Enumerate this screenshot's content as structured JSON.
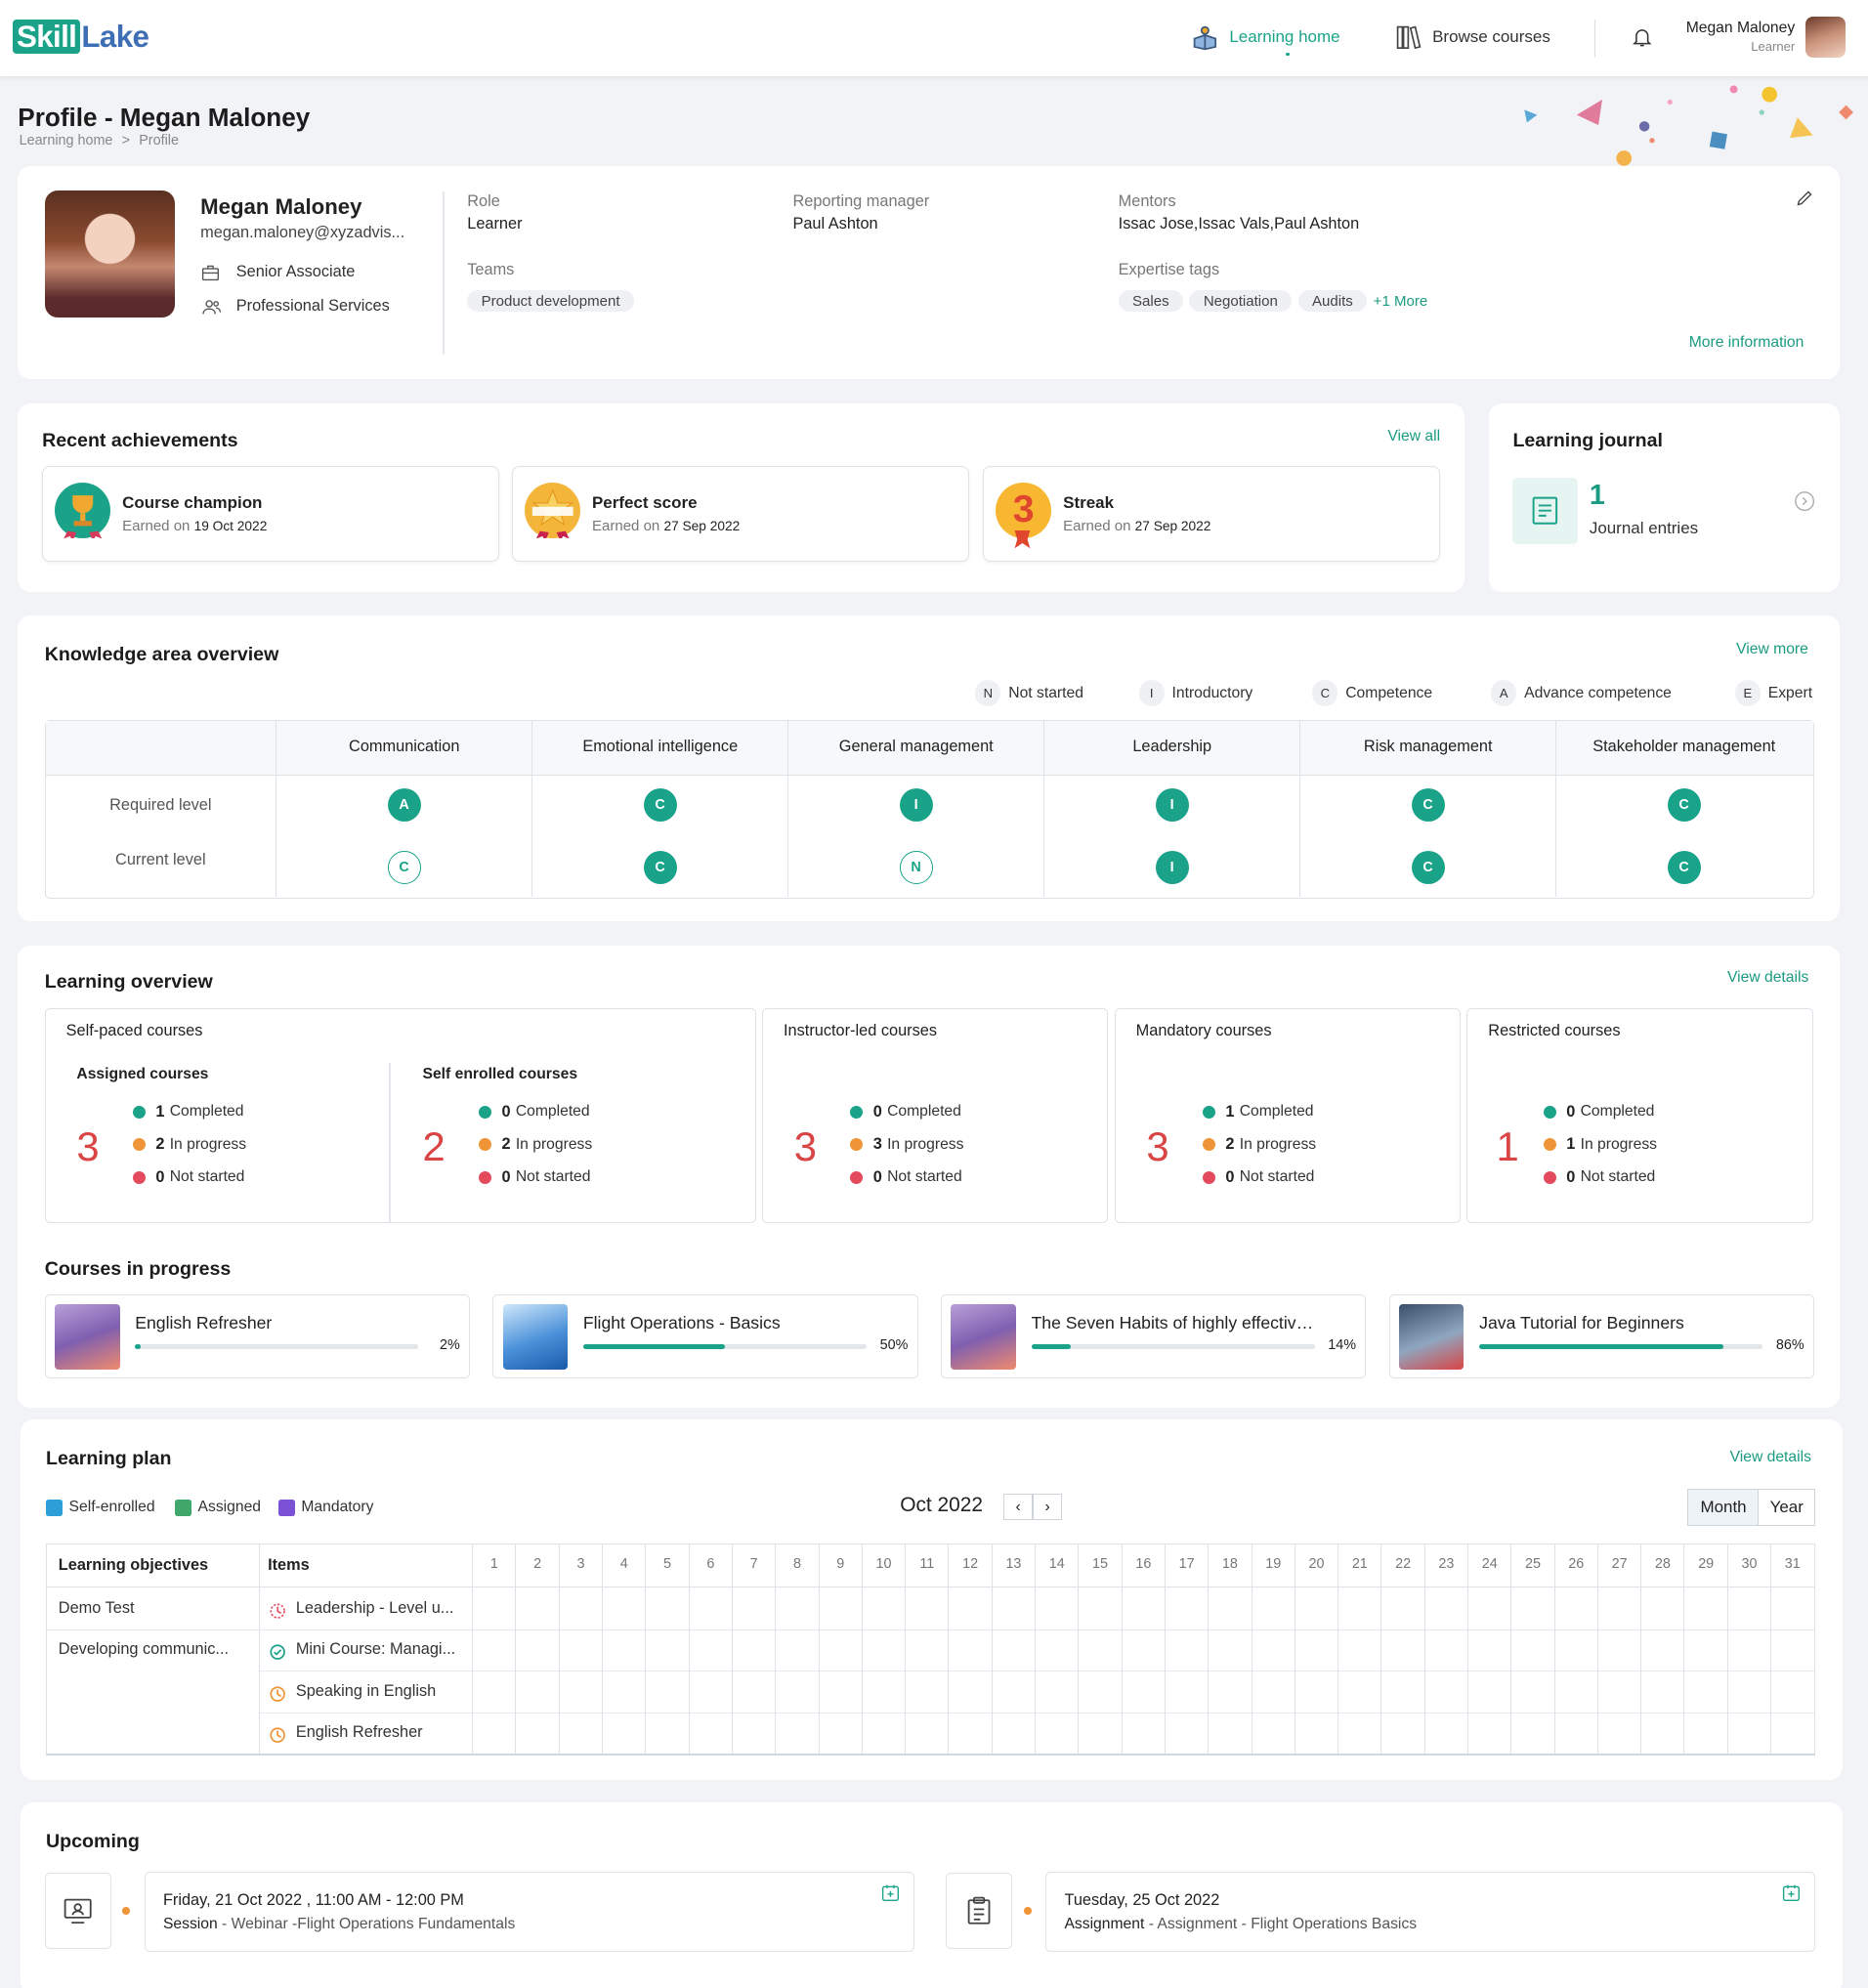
{
  "brand": {
    "logo_a": "Skill",
    "logo_b": "Lake"
  },
  "header": {
    "nav_learning_home": "Learning home",
    "nav_browse": "Browse courses",
    "user_name": "Megan Maloney",
    "user_role": "Learner"
  },
  "page": {
    "title": "Profile - Megan Maloney",
    "breadcrumb_home": "Learning home",
    "breadcrumb_sep": ">",
    "breadcrumb_current": "Profile"
  },
  "profile": {
    "name": "Megan Maloney",
    "email": "megan.maloney@xyzadvis...",
    "designation": "Senior Associate",
    "department": "Professional Services",
    "role_label": "Role",
    "role": "Learner",
    "manager_label": "Reporting manager",
    "manager": "Paul Ashton",
    "mentors_label": "Mentors",
    "mentors": "Issac Jose,Issac Vals,Paul Ashton",
    "teams_label": "Teams",
    "teams": [
      "Product development"
    ],
    "tags_label": "Expertise tags",
    "tags": [
      "Sales",
      "Negotiation",
      "Audits"
    ],
    "tags_more": "+1 More",
    "more_info": "More information"
  },
  "achievements": {
    "title": "Recent achievements",
    "view_all": "View all",
    "earned_prefix": "Earned on",
    "items": [
      {
        "title": "Course champion",
        "date": "19 Oct 2022"
      },
      {
        "title": "Perfect score",
        "date": "27 Sep 2022"
      },
      {
        "title": "Streak",
        "date": "27 Sep 2022",
        "badge": "3"
      }
    ]
  },
  "journal": {
    "title": "Learning journal",
    "count": "1",
    "label": "Journal entries"
  },
  "knowledge": {
    "title": "Knowledge area overview",
    "view_more": "View more",
    "legend": [
      {
        "code": "N",
        "label": "Not started"
      },
      {
        "code": "I",
        "label": "Introductory"
      },
      {
        "code": "C",
        "label": "Competence"
      },
      {
        "code": "A",
        "label": "Advance competence"
      },
      {
        "code": "E",
        "label": "Expert"
      }
    ],
    "row_required": "Required level",
    "row_current": "Current level",
    "areas": [
      {
        "name": "Communication",
        "required": "A",
        "current": "C",
        "current_met": false
      },
      {
        "name": "Emotional intelligence",
        "required": "C",
        "current": "C",
        "current_met": true
      },
      {
        "name": "General management",
        "required": "I",
        "current": "N",
        "current_met": false
      },
      {
        "name": "Leadership",
        "required": "I",
        "current": "I",
        "current_met": true
      },
      {
        "name": "Risk management",
        "required": "C",
        "current": "C",
        "current_met": true
      },
      {
        "name": "Stakeholder management",
        "required": "C",
        "current": "C",
        "current_met": true
      }
    ]
  },
  "overview": {
    "title": "Learning overview",
    "view_details": "View details",
    "self_paced": "Self-paced courses",
    "assigned": "Assigned courses",
    "self_enrolled": "Self enrolled courses",
    "instructor": "Instructor-led courses",
    "mandatory": "Mandatory courses",
    "restricted": "Restricted courses",
    "completed": "Completed",
    "in_progress": "In progress",
    "not_started": "Not started",
    "groups": [
      {
        "total": "3",
        "c": "1",
        "p": "2",
        "n": "0"
      },
      {
        "total": "2",
        "c": "0",
        "p": "2",
        "n": "0"
      },
      {
        "total": "3",
        "c": "0",
        "p": "3",
        "n": "0"
      },
      {
        "total": "3",
        "c": "1",
        "p": "2",
        "n": "0"
      },
      {
        "total": "1",
        "c": "0",
        "p": "1",
        "n": "0"
      }
    ]
  },
  "courses_in_progress": {
    "title": "Courses in progress",
    "items": [
      {
        "name": "English Refresher",
        "pct": "2%",
        "progress": 0.02
      },
      {
        "name": "Flight Operations - Basics",
        "pct": "50%",
        "progress": 0.5
      },
      {
        "name": "The Seven Habits of highly effective p...",
        "pct": "14%",
        "progress": 0.14
      },
      {
        "name": "Java Tutorial for Beginners",
        "pct": "86%",
        "progress": 0.86
      }
    ]
  },
  "plan": {
    "title": "Learning plan",
    "view_details": "View details",
    "legend": [
      {
        "label": "Self-enrolled",
        "color": "#2d9fd8"
      },
      {
        "label": "Assigned",
        "color": "#3fa86a"
      },
      {
        "label": "Mandatory",
        "color": "#7b52d6"
      }
    ],
    "month": "Oct 2022",
    "prev": "‹",
    "next": "›",
    "view_month": "Month",
    "view_year": "Year",
    "col_objectives": "Learning objectives",
    "col_items": "Items",
    "days": [
      "1",
      "2",
      "3",
      "4",
      "5",
      "6",
      "7",
      "8",
      "9",
      "10",
      "11",
      "12",
      "13",
      "14",
      "15",
      "16",
      "17",
      "18",
      "19",
      "20",
      "21",
      "22",
      "23",
      "24",
      "25",
      "26",
      "27",
      "28",
      "29",
      "30",
      "31"
    ],
    "rows": [
      {
        "objective": "Demo Test",
        "item": "Leadership - Level u...",
        "icon": "dashed-clock-icon"
      },
      {
        "objective": "Developing communic...",
        "item": "Mini Course: Managi...",
        "icon": "check-circle-icon"
      },
      {
        "objective": "",
        "item": "Speaking in English",
        "icon": "clock-icon"
      },
      {
        "objective": "",
        "item": "English Refresher",
        "icon": "clock-icon"
      }
    ]
  },
  "upcoming": {
    "title": "Upcoming",
    "items": [
      {
        "when": "Friday, 21 Oct 2022 , 11:00 AM - 12:00 PM",
        "type": "Session",
        "desc": " - Webinar -Flight Operations Fundamentals",
        "icon": "session-icon"
      },
      {
        "when": "Tuesday, 25 Oct 2022",
        "type": "Assignment",
        "desc": " - Assignment - Flight Operations Basics",
        "icon": "assignment-icon"
      }
    ]
  }
}
